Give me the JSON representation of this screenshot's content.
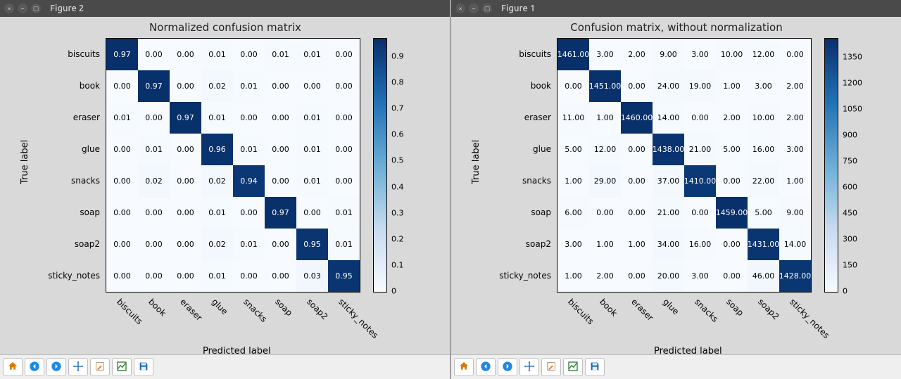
{
  "figures": [
    {
      "window_title": "Figure 2",
      "plot_title": "Normalized confusion matrix",
      "ylabel": "True label",
      "xlabel": "Predicted label"
    },
    {
      "window_title": "Figure 1",
      "plot_title": "Confusion matrix, without normalization",
      "ylabel": "True label",
      "xlabel": "Predicted label"
    }
  ],
  "labels": [
    "biscuits",
    "book",
    "eraser",
    "glue",
    "snacks",
    "soap",
    "soap2",
    "sticky_notes"
  ],
  "toolbar_buttons": [
    "home",
    "back",
    "forward",
    "pan",
    "edit",
    "subplots",
    "save"
  ],
  "chart_data": [
    {
      "type": "heatmap",
      "title": "Normalized confusion matrix",
      "xlabel": "Predicted label",
      "ylabel": "True label",
      "categories": [
        "biscuits",
        "book",
        "eraser",
        "glue",
        "snacks",
        "soap",
        "soap2",
        "sticky_notes"
      ],
      "values": [
        [
          0.97,
          0.0,
          0.0,
          0.01,
          0.0,
          0.01,
          0.01,
          0.0
        ],
        [
          0.0,
          0.97,
          0.0,
          0.02,
          0.01,
          0.0,
          0.0,
          0.0
        ],
        [
          0.01,
          0.0,
          0.97,
          0.01,
          0.0,
          0.0,
          0.01,
          0.0
        ],
        [
          0.0,
          0.01,
          0.0,
          0.96,
          0.01,
          0.0,
          0.01,
          0.0
        ],
        [
          0.0,
          0.02,
          0.0,
          0.02,
          0.94,
          0.0,
          0.01,
          0.0
        ],
        [
          0.0,
          0.0,
          0.0,
          0.01,
          0.0,
          0.97,
          0.0,
          0.01
        ],
        [
          0.0,
          0.0,
          0.0,
          0.02,
          0.01,
          0.0,
          0.95,
          0.01
        ],
        [
          0.0,
          0.0,
          0.0,
          0.01,
          0.0,
          0.0,
          0.03,
          0.95
        ]
      ],
      "colorbar_ticks": [
        0.0,
        0.1,
        0.2,
        0.3,
        0.4,
        0.5,
        0.6,
        0.7,
        0.8,
        0.9
      ],
      "vmin": 0.0,
      "vmax": 0.97
    },
    {
      "type": "heatmap",
      "title": "Confusion matrix, without normalization",
      "xlabel": "Predicted label",
      "ylabel": "True label",
      "categories": [
        "biscuits",
        "book",
        "eraser",
        "glue",
        "snacks",
        "soap",
        "soap2",
        "sticky_notes"
      ],
      "values": [
        [
          1461.0,
          3.0,
          2.0,
          9.0,
          3.0,
          10.0,
          12.0,
          0.0
        ],
        [
          0.0,
          1451.0,
          0.0,
          24.0,
          19.0,
          1.0,
          3.0,
          2.0
        ],
        [
          11.0,
          1.0,
          1460.0,
          14.0,
          0.0,
          2.0,
          10.0,
          2.0
        ],
        [
          5.0,
          12.0,
          0.0,
          1438.0,
          21.0,
          5.0,
          16.0,
          3.0
        ],
        [
          1.0,
          29.0,
          0.0,
          37.0,
          1410.0,
          0.0,
          22.0,
          1.0
        ],
        [
          6.0,
          0.0,
          0.0,
          21.0,
          0.0,
          1459.0,
          5.0,
          9.0
        ],
        [
          3.0,
          1.0,
          1.0,
          34.0,
          16.0,
          0.0,
          1431.0,
          14.0
        ],
        [
          1.0,
          2.0,
          0.0,
          20.0,
          3.0,
          0.0,
          46.0,
          1428.0
        ]
      ],
      "colorbar_ticks": [
        0,
        150,
        300,
        450,
        600,
        750,
        900,
        1050,
        1200,
        1350
      ],
      "vmin": 0.0,
      "vmax": 1461.0
    }
  ]
}
